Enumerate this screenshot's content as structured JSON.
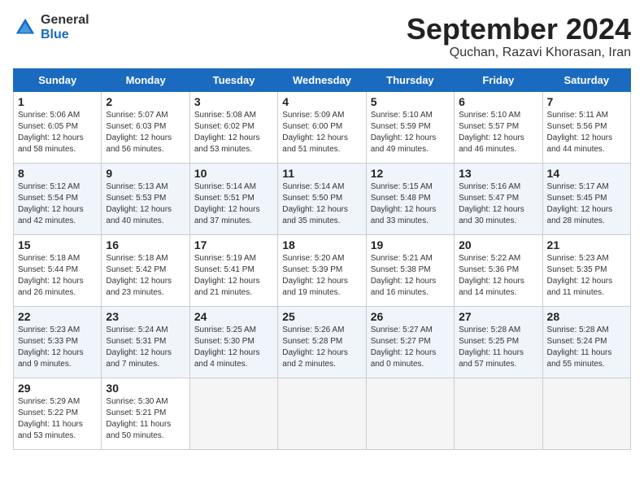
{
  "header": {
    "logo_general": "General",
    "logo_blue": "Blue",
    "month_title": "September 2024",
    "location": "Quchan, Razavi Khorasan, Iran"
  },
  "days_of_week": [
    "Sunday",
    "Monday",
    "Tuesday",
    "Wednesday",
    "Thursday",
    "Friday",
    "Saturday"
  ],
  "weeks": [
    [
      {
        "day": "1",
        "info": "Sunrise: 5:06 AM\nSunset: 6:05 PM\nDaylight: 12 hours\nand 58 minutes."
      },
      {
        "day": "2",
        "info": "Sunrise: 5:07 AM\nSunset: 6:03 PM\nDaylight: 12 hours\nand 56 minutes."
      },
      {
        "day": "3",
        "info": "Sunrise: 5:08 AM\nSunset: 6:02 PM\nDaylight: 12 hours\nand 53 minutes."
      },
      {
        "day": "4",
        "info": "Sunrise: 5:09 AM\nSunset: 6:00 PM\nDaylight: 12 hours\nand 51 minutes."
      },
      {
        "day": "5",
        "info": "Sunrise: 5:10 AM\nSunset: 5:59 PM\nDaylight: 12 hours\nand 49 minutes."
      },
      {
        "day": "6",
        "info": "Sunrise: 5:10 AM\nSunset: 5:57 PM\nDaylight: 12 hours\nand 46 minutes."
      },
      {
        "day": "7",
        "info": "Sunrise: 5:11 AM\nSunset: 5:56 PM\nDaylight: 12 hours\nand 44 minutes."
      }
    ],
    [
      {
        "day": "8",
        "info": "Sunrise: 5:12 AM\nSunset: 5:54 PM\nDaylight: 12 hours\nand 42 minutes."
      },
      {
        "day": "9",
        "info": "Sunrise: 5:13 AM\nSunset: 5:53 PM\nDaylight: 12 hours\nand 40 minutes."
      },
      {
        "day": "10",
        "info": "Sunrise: 5:14 AM\nSunset: 5:51 PM\nDaylight: 12 hours\nand 37 minutes."
      },
      {
        "day": "11",
        "info": "Sunrise: 5:14 AM\nSunset: 5:50 PM\nDaylight: 12 hours\nand 35 minutes."
      },
      {
        "day": "12",
        "info": "Sunrise: 5:15 AM\nSunset: 5:48 PM\nDaylight: 12 hours\nand 33 minutes."
      },
      {
        "day": "13",
        "info": "Sunrise: 5:16 AM\nSunset: 5:47 PM\nDaylight: 12 hours\nand 30 minutes."
      },
      {
        "day": "14",
        "info": "Sunrise: 5:17 AM\nSunset: 5:45 PM\nDaylight: 12 hours\nand 28 minutes."
      }
    ],
    [
      {
        "day": "15",
        "info": "Sunrise: 5:18 AM\nSunset: 5:44 PM\nDaylight: 12 hours\nand 26 minutes."
      },
      {
        "day": "16",
        "info": "Sunrise: 5:18 AM\nSunset: 5:42 PM\nDaylight: 12 hours\nand 23 minutes."
      },
      {
        "day": "17",
        "info": "Sunrise: 5:19 AM\nSunset: 5:41 PM\nDaylight: 12 hours\nand 21 minutes."
      },
      {
        "day": "18",
        "info": "Sunrise: 5:20 AM\nSunset: 5:39 PM\nDaylight: 12 hours\nand 19 minutes."
      },
      {
        "day": "19",
        "info": "Sunrise: 5:21 AM\nSunset: 5:38 PM\nDaylight: 12 hours\nand 16 minutes."
      },
      {
        "day": "20",
        "info": "Sunrise: 5:22 AM\nSunset: 5:36 PM\nDaylight: 12 hours\nand 14 minutes."
      },
      {
        "day": "21",
        "info": "Sunrise: 5:23 AM\nSunset: 5:35 PM\nDaylight: 12 hours\nand 11 minutes."
      }
    ],
    [
      {
        "day": "22",
        "info": "Sunrise: 5:23 AM\nSunset: 5:33 PM\nDaylight: 12 hours\nand 9 minutes."
      },
      {
        "day": "23",
        "info": "Sunrise: 5:24 AM\nSunset: 5:31 PM\nDaylight: 12 hours\nand 7 minutes."
      },
      {
        "day": "24",
        "info": "Sunrise: 5:25 AM\nSunset: 5:30 PM\nDaylight: 12 hours\nand 4 minutes."
      },
      {
        "day": "25",
        "info": "Sunrise: 5:26 AM\nSunset: 5:28 PM\nDaylight: 12 hours\nand 2 minutes."
      },
      {
        "day": "26",
        "info": "Sunrise: 5:27 AM\nSunset: 5:27 PM\nDaylight: 12 hours\nand 0 minutes."
      },
      {
        "day": "27",
        "info": "Sunrise: 5:28 AM\nSunset: 5:25 PM\nDaylight: 11 hours\nand 57 minutes."
      },
      {
        "day": "28",
        "info": "Sunrise: 5:28 AM\nSunset: 5:24 PM\nDaylight: 11 hours\nand 55 minutes."
      }
    ],
    [
      {
        "day": "29",
        "info": "Sunrise: 5:29 AM\nSunset: 5:22 PM\nDaylight: 11 hours\nand 53 minutes."
      },
      {
        "day": "30",
        "info": "Sunrise: 5:30 AM\nSunset: 5:21 PM\nDaylight: 11 hours\nand 50 minutes."
      },
      {
        "day": "",
        "info": ""
      },
      {
        "day": "",
        "info": ""
      },
      {
        "day": "",
        "info": ""
      },
      {
        "day": "",
        "info": ""
      },
      {
        "day": "",
        "info": ""
      }
    ]
  ]
}
